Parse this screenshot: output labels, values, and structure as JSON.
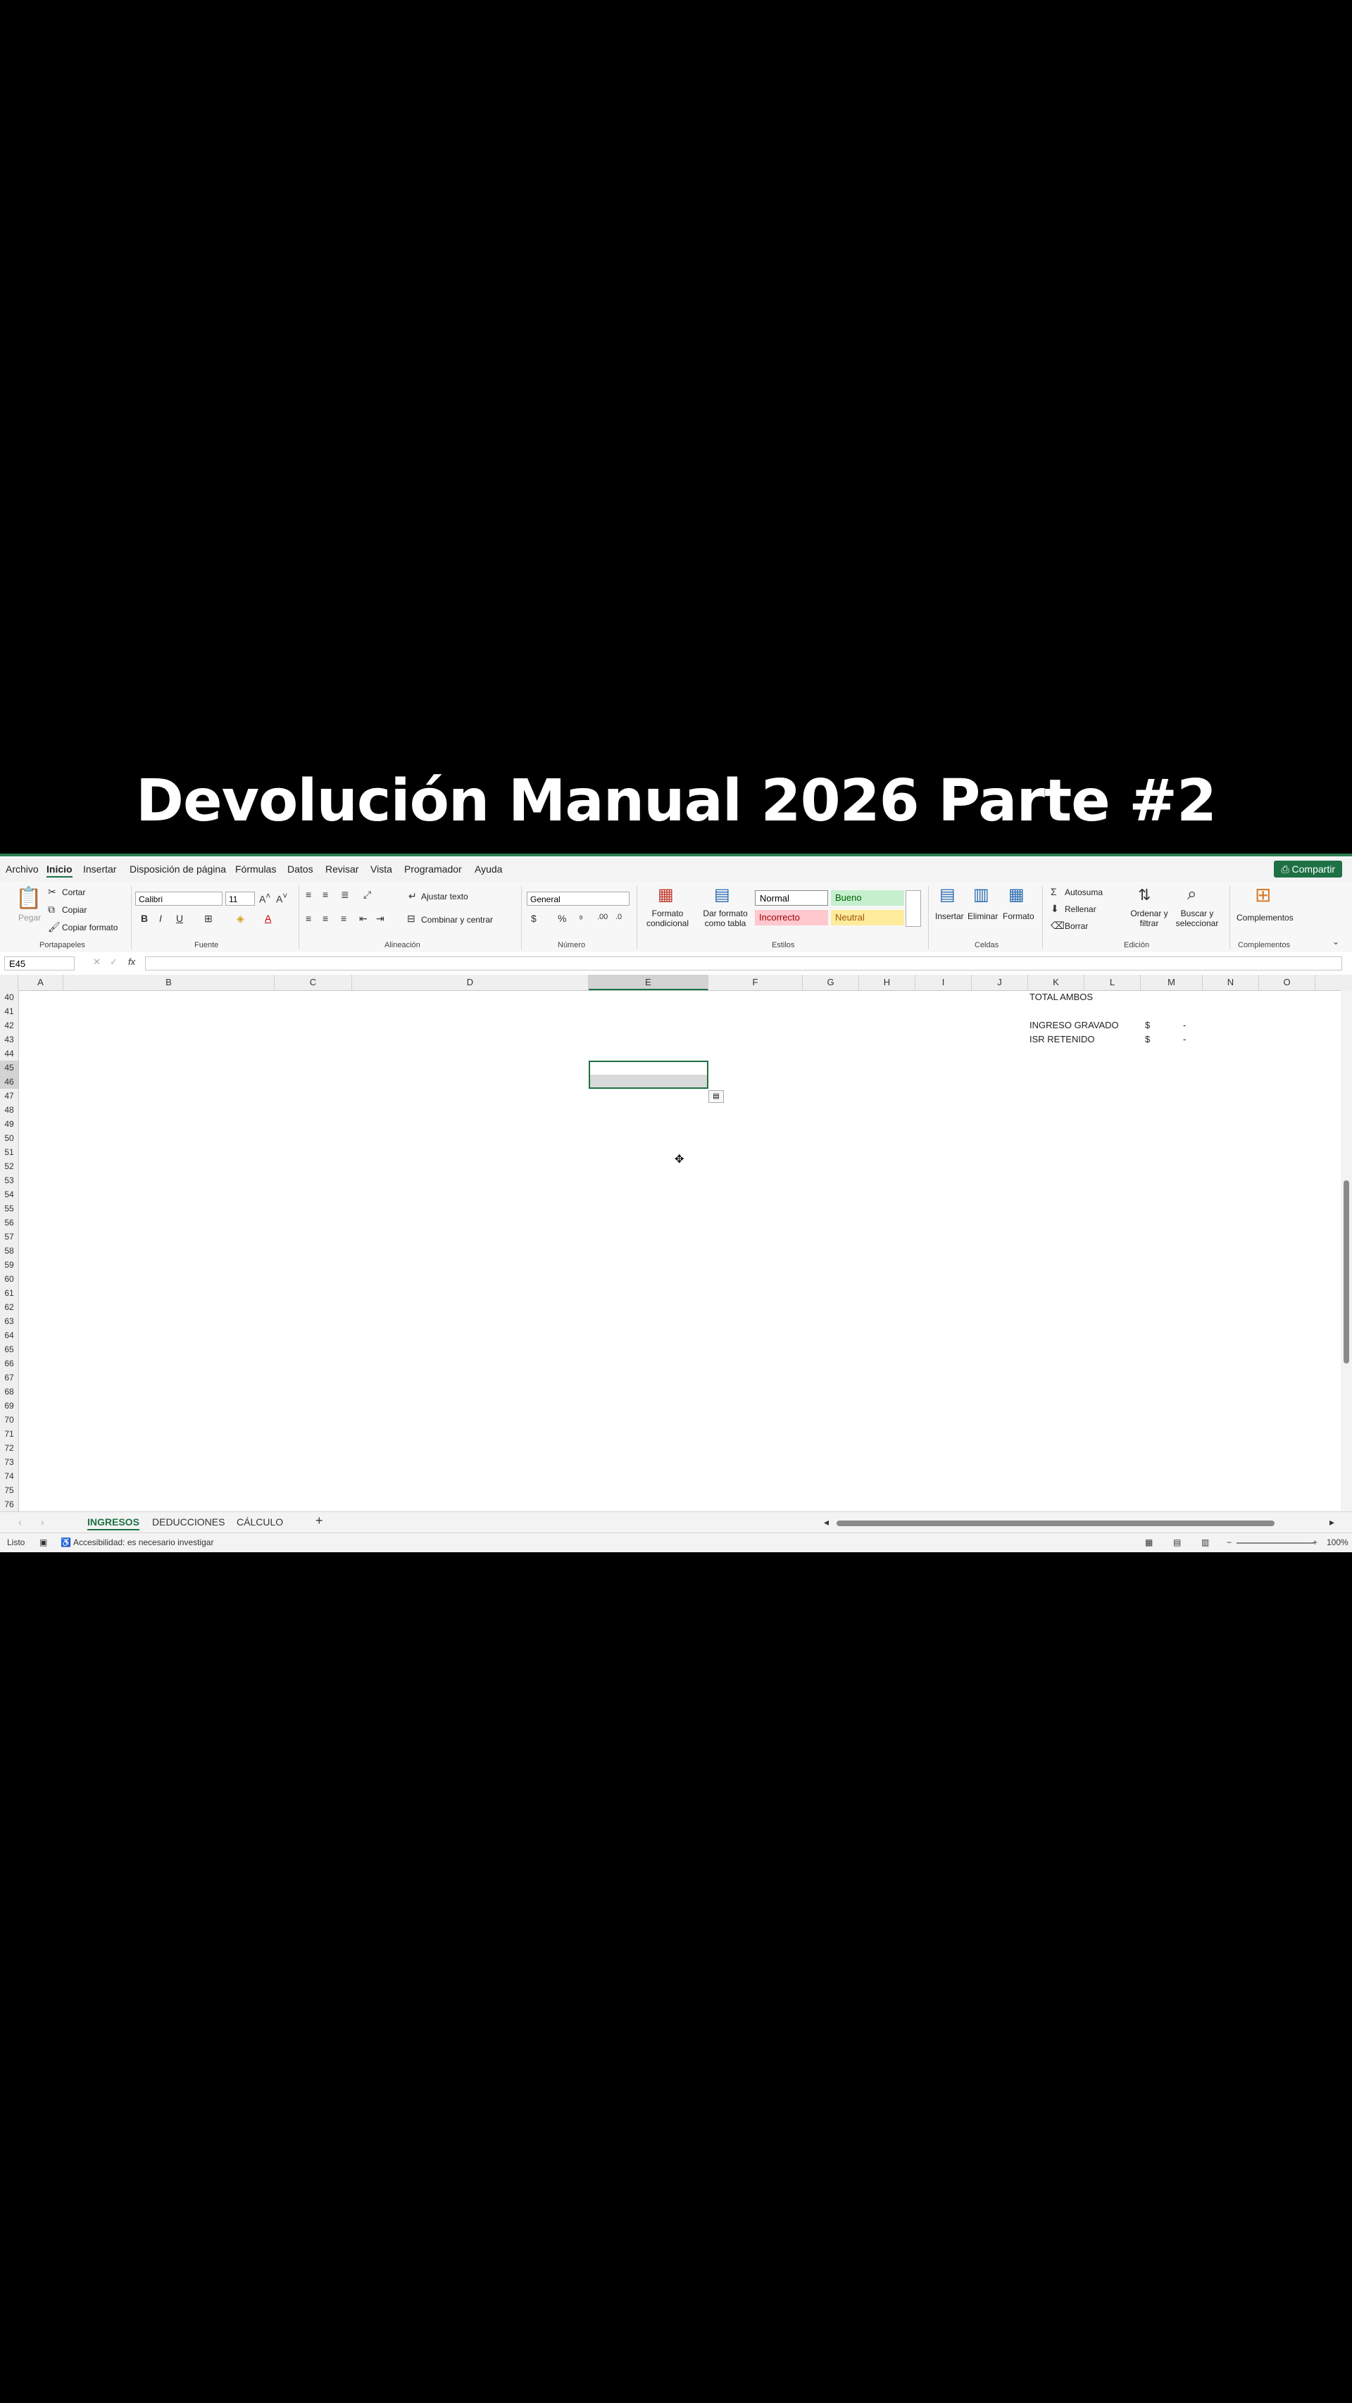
{
  "caption": "Devolución Manual 2026 Parte #2",
  "menu": {
    "items": [
      "Archivo",
      "Inicio",
      "Insertar",
      "Disposición de página",
      "Fórmulas",
      "Datos",
      "Revisar",
      "Vista",
      "Programador",
      "Ayuda"
    ],
    "share_label": "Compartir"
  },
  "ribbon": {
    "clipboard": {
      "paste": "Pegar",
      "cut": "Cortar",
      "copy": "Copiar",
      "format_painter": "Copiar formato",
      "group": "Portapapeles"
    },
    "font": {
      "name": "Calibri",
      "size": "11",
      "group": "Fuente"
    },
    "alignment": {
      "wrap": "Ajustar texto",
      "merge": "Combinar y centrar",
      "group": "Alineación"
    },
    "number": {
      "format": "General",
      "group": "Número"
    },
    "styles": {
      "cond_format": "Formato condicional",
      "table_format": "Dar formato como tabla",
      "normal": "Normal",
      "good": "Bueno",
      "bad": "Incorrecto",
      "neutral": "Neutral",
      "group": "Estilos"
    },
    "cells": {
      "insert": "Insertar",
      "delete": "Eliminar",
      "format": "Formato",
      "group": "Celdas"
    },
    "editing": {
      "autosum": "Autosuma",
      "fill": "Rellenar",
      "clear": "Borrar",
      "sort": "Ordenar y filtrar",
      "find": "Buscar y seleccionar",
      "group": "Edición"
    },
    "addins": {
      "label": "Complementos",
      "group": "Complementos"
    }
  },
  "formula_bar": {
    "name_box": "E45",
    "fx": "fx",
    "value": ""
  },
  "columns": [
    "A",
    "B",
    "C",
    "D",
    "E",
    "F",
    "G",
    "H",
    "I",
    "J",
    "K",
    "L",
    "M",
    "N",
    "O"
  ],
  "rows": [
    "40",
    "41",
    "42",
    "43",
    "44",
    "45",
    "46",
    "47",
    "48",
    "49",
    "50",
    "51",
    "52",
    "53",
    "54",
    "55",
    "56",
    "57",
    "58",
    "59",
    "60",
    "61",
    "62",
    "63",
    "64",
    "65",
    "66",
    "67",
    "68",
    "69",
    "70",
    "71",
    "72",
    "73",
    "74",
    "75",
    "76"
  ],
  "cells": {
    "total_ambos": "TOTAL AMBOS",
    "ingreso_gravado": "INGRESO GRAVADO",
    "isr_retenido": "ISR RETENIDO",
    "currency": "$",
    "dash": "-"
  },
  "sheet_tabs": [
    "INGRESOS",
    "DEDUCCIONES",
    "CÁLCULO"
  ],
  "status": {
    "mode": "Listo",
    "accessibility": "Accesibilidad: es necesario investigar",
    "zoom": "100%"
  }
}
